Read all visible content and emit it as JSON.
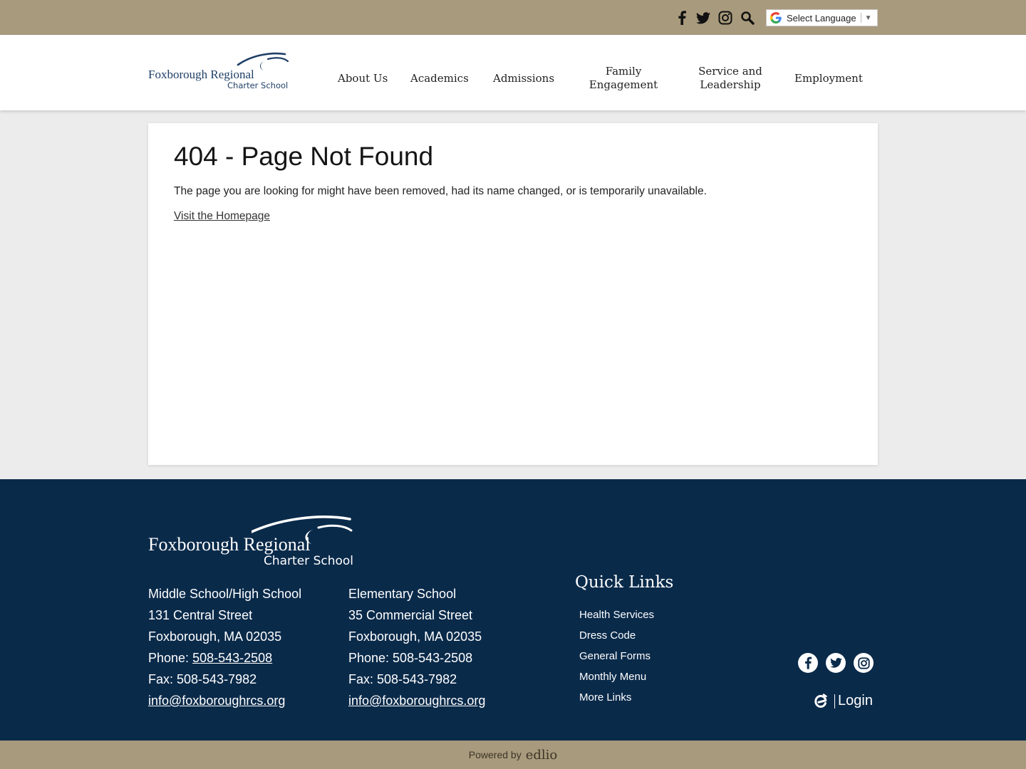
{
  "topbar": {
    "social_icons": [
      "facebook-icon",
      "twitter-icon",
      "instagram-icon",
      "search-icon"
    ],
    "language_select": "Select Language",
    "bar_color": "#a89a7c"
  },
  "header": {
    "logo": {
      "line1": "Foxborough Regional",
      "line2": "Charter School"
    },
    "nav": {
      "about": "About Us",
      "academics": "Academics",
      "admissions": "Admissions",
      "family_1": "Family",
      "family_2": "Engagement",
      "service_1": "Service and",
      "service_2": "Leadership",
      "employment": "Employment"
    }
  },
  "main": {
    "title": "404 - Page Not Found",
    "message": "The page you are looking for might have been removed, had its name changed, or is temporarily unavailable.",
    "home_link": "Visit the Homepage"
  },
  "footer": {
    "bg_color": "#0a2a4a",
    "logo": {
      "line1": "Foxborough Regional",
      "line2": "Charter School"
    },
    "campus1": {
      "name": "Middle School/High School",
      "street": "131 Central Street",
      "city": "Foxborough, MA 02035",
      "phone_label": "Phone: ",
      "phone": "508-543-2508",
      "fax": "Fax: 508-543-7982",
      "email": "info@foxboroughrcs.org"
    },
    "campus2": {
      "name": "Elementary School",
      "street": "35 Commercial Street",
      "city": "Foxborough, MA 02035",
      "phone": "Phone: 508-543-2508",
      "fax": "Fax: 508-543-7982",
      "email": "info@foxboroughrcs.org"
    },
    "quick_links": {
      "title": "Quick Links",
      "items": [
        "Health Services",
        "Dress Code",
        "General Forms",
        "Monthly Menu",
        "More Links"
      ]
    },
    "login": "Login",
    "powered_by": "Powered by",
    "powered_brand": "edlio"
  }
}
